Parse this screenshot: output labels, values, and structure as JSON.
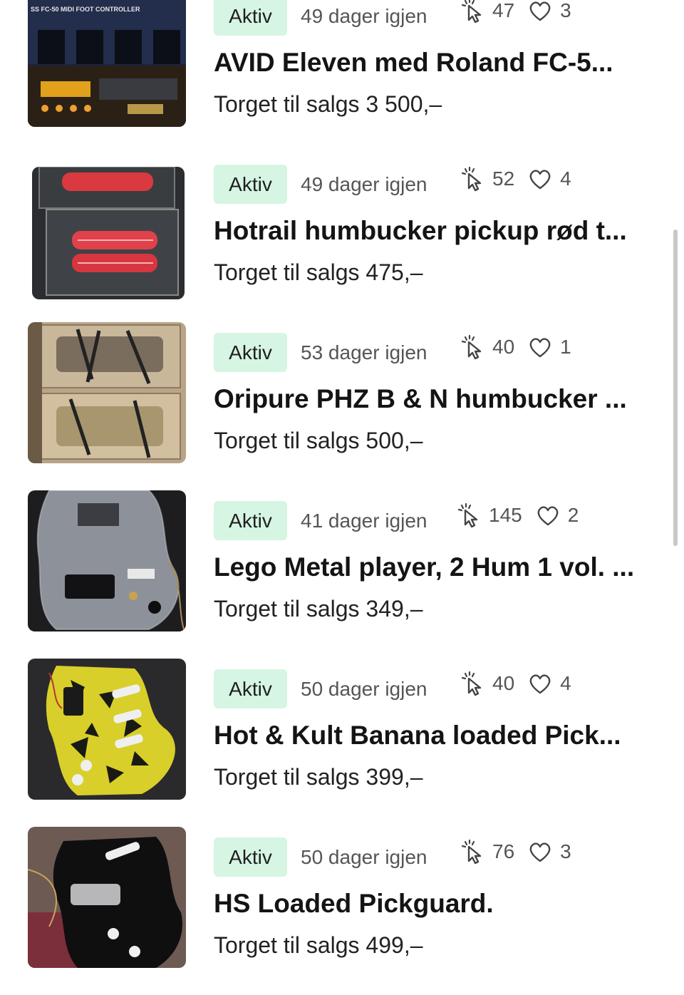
{
  "listings": [
    {
      "status": "Aktiv",
      "days_left": "49 dager igjen",
      "clicks": "47",
      "likes": "3",
      "title": "AVID Eleven med Roland FC-5...",
      "price": "Torget til salgs 3 500,–",
      "thumb_text": "SS FC-50 MIDI FOOT CONTROLLER"
    },
    {
      "status": "Aktiv",
      "days_left": "49 dager igjen",
      "clicks": "52",
      "likes": "4",
      "title": "Hotrail humbucker pickup rød t...",
      "price": "Torget til salgs 475,–"
    },
    {
      "status": "Aktiv",
      "days_left": "53 dager igjen",
      "clicks": "40",
      "likes": "1",
      "title": "Oripure PHZ B & N humbucker ...",
      "price": "Torget til salgs 500,–"
    },
    {
      "status": "Aktiv",
      "days_left": "41 dager igjen",
      "clicks": "145",
      "likes": "2",
      "title": "Lego Metal player, 2 Hum 1 vol. ...",
      "price": "Torget til salgs 349,–"
    },
    {
      "status": "Aktiv",
      "days_left": "50 dager igjen",
      "clicks": "40",
      "likes": "4",
      "title": "Hot & Kult Banana loaded Pick...",
      "price": "Torget til salgs 399,–"
    },
    {
      "status": "Aktiv",
      "days_left": "50 dager igjen",
      "clicks": "76",
      "likes": "3",
      "title": "HS Loaded Pickguard.",
      "price": "Torget til salgs 499,–"
    }
  ],
  "icons": {
    "clicks": "cursor-click-icon",
    "likes": "heart-icon"
  },
  "colors": {
    "badge_bg": "#d6f5e3",
    "text_primary": "#141414",
    "text_secondary": "#555555"
  }
}
